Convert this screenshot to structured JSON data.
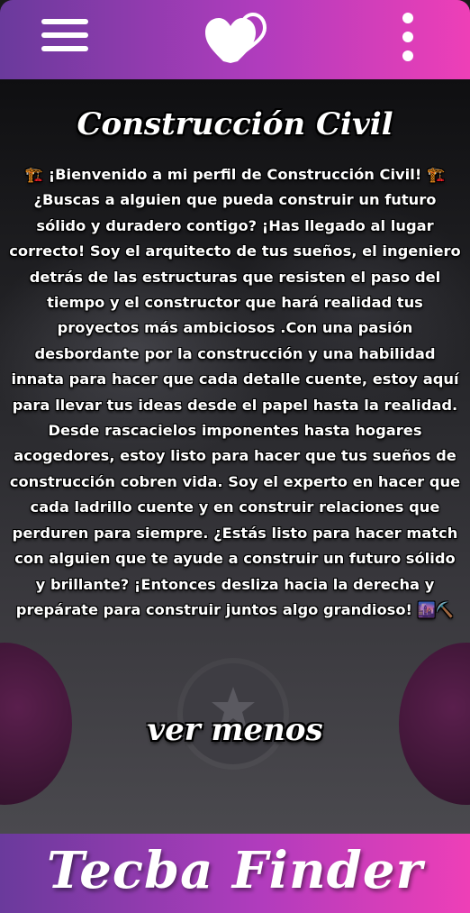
{
  "header": {
    "menu_icon": "hamburger-menu-icon",
    "logo_icon": "double-heart-logo-icon",
    "more_icon": "vertical-dots-icon"
  },
  "profile": {
    "title": "Construcción Civil",
    "bio_lines": [
      "¡Bienvenido a mi perfil de Construcción Civil!",
      "¿Buscas a alguien que pueda construir un futuro",
      "sólido y duradero contigo? ¡Has llegado al lugar",
      "correcto! Soy el arquitecto de tus sueños, el ingeniero",
      "detrás de las estructuras que resisten el paso del",
      "tiempo y el constructor que hará realidad tus",
      "proyectos más ambiciosos .Con una pasión",
      "desbordante por la construcción y una habilidad",
      "innata para hacer que cada detalle cuente, estoy aquí",
      "para llevar tus ideas desde el papel hasta la realidad.",
      "Desde rascacielos imponentes hasta hogares",
      "acogedores, estoy listo para hacer que tus sueños de",
      "construcción cobren vida. Soy el experto en hacer que",
      "cada ladrillo cuente y en construir relaciones que",
      "perduren para siempre. ¿Estás listo para hacer match",
      "con alguien que te ayude a construir un futuro sólido",
      "y brillante? ¡Entonces desliza hacia la derecha y",
      "prepárate para construir juntos algo grandioso!"
    ],
    "emoji_crane": "🏗️",
    "emoji_end_city": "🌆",
    "emoji_end_pick": "⛏️",
    "toggle_label": "ver menos"
  },
  "actions": {
    "left_icon": "dislike-circle-icon",
    "center_icon": "star-icon",
    "right_icon": "like-circle-icon"
  },
  "footer": {
    "brand": "Tecba Finder"
  },
  "colors": {
    "gradient_start": "#6a3a9c",
    "gradient_mid": "#b03cbd",
    "gradient_end": "#ee3fb7"
  }
}
